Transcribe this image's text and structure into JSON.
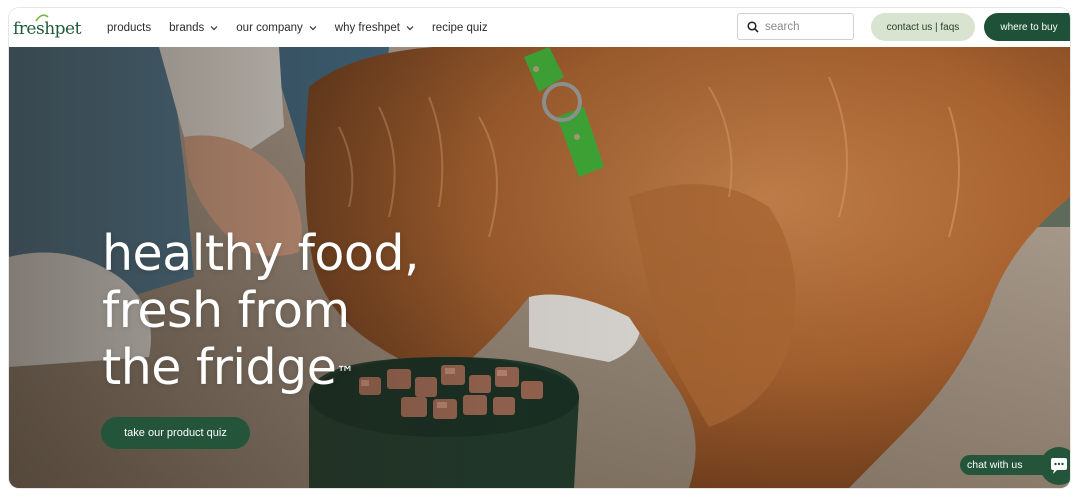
{
  "brand": {
    "logo_text": "freshpet",
    "colors": {
      "primary_green": "#1f5138",
      "light_green": "#d9e4d0",
      "collar_green": "#3fb23a"
    }
  },
  "nav": {
    "items": [
      {
        "label": "products",
        "has_dropdown": false
      },
      {
        "label": "brands",
        "has_dropdown": true
      },
      {
        "label": "our company",
        "has_dropdown": true
      },
      {
        "label": "why freshpet",
        "has_dropdown": true
      },
      {
        "label": "recipe quiz",
        "has_dropdown": false
      }
    ],
    "search": {
      "placeholder": "search",
      "icon": "search-icon"
    },
    "contact_label": "contact us | faqs",
    "buy_label": "where to buy"
  },
  "hero": {
    "headline_line1": "healthy food,",
    "headline_line2": "fresh from",
    "headline_line3": "the fridge",
    "trademark": "™",
    "cta_label": "take our product quiz"
  },
  "chat": {
    "label": "chat with us",
    "icon": "chat-bubble-icon"
  }
}
